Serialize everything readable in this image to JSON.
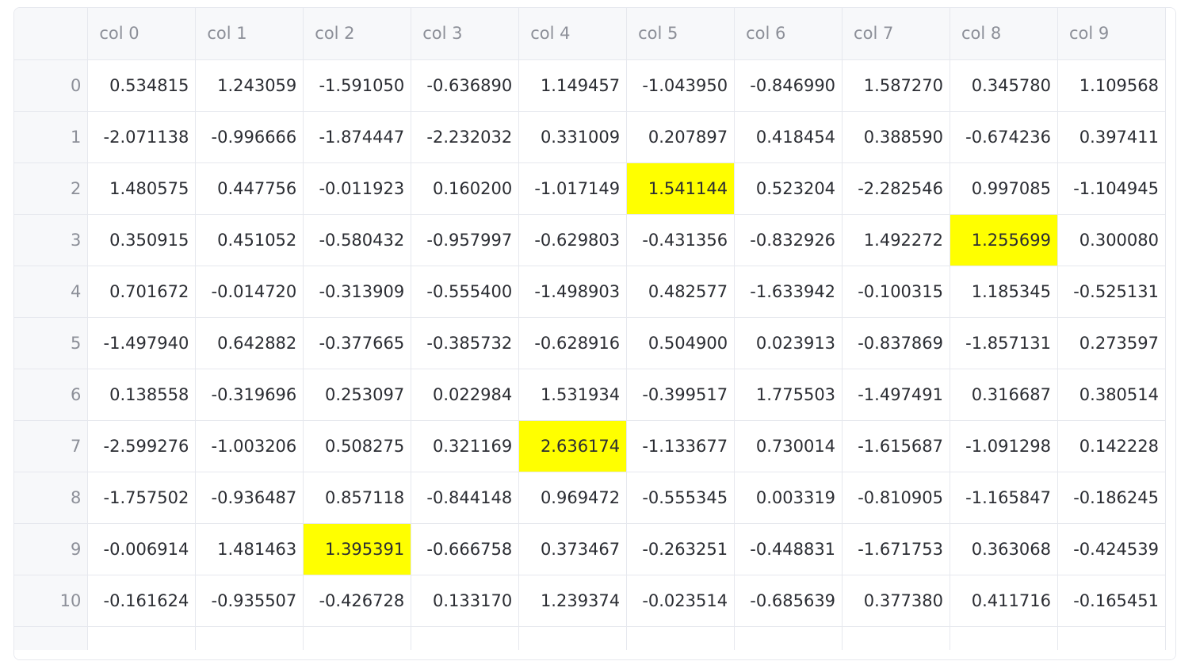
{
  "table": {
    "columns": [
      "col 0",
      "col 1",
      "col 2",
      "col 3",
      "col 4",
      "col 5",
      "col 6",
      "col 7",
      "col 8",
      "col 9"
    ],
    "rows": [
      {
        "index": "0",
        "cells": [
          "0.534815",
          "1.243059",
          "-1.591050",
          "-0.636890",
          "1.149457",
          "-1.043950",
          "-0.846990",
          "1.587270",
          "0.345780",
          "1.109568"
        ],
        "highlight": []
      },
      {
        "index": "1",
        "cells": [
          "-2.071138",
          "-0.996666",
          "-1.874447",
          "-2.232032",
          "0.331009",
          "0.207897",
          "0.418454",
          "0.388590",
          "-0.674236",
          "0.397411"
        ],
        "highlight": []
      },
      {
        "index": "2",
        "cells": [
          "1.480575",
          "0.447756",
          "-0.011923",
          "0.160200",
          "-1.017149",
          "1.541144",
          "0.523204",
          "-2.282546",
          "0.997085",
          "-1.104945"
        ],
        "highlight": [
          5
        ]
      },
      {
        "index": "3",
        "cells": [
          "0.350915",
          "0.451052",
          "-0.580432",
          "-0.957997",
          "-0.629803",
          "-0.431356",
          "-0.832926",
          "1.492272",
          "1.255699",
          "0.300080"
        ],
        "highlight": [
          8
        ]
      },
      {
        "index": "4",
        "cells": [
          "0.701672",
          "-0.014720",
          "-0.313909",
          "-0.555400",
          "-1.498903",
          "0.482577",
          "-1.633942",
          "-0.100315",
          "1.185345",
          "-0.525131"
        ],
        "highlight": []
      },
      {
        "index": "5",
        "cells": [
          "-1.497940",
          "0.642882",
          "-0.377665",
          "-0.385732",
          "-0.628916",
          "0.504900",
          "0.023913",
          "-0.837869",
          "-1.857131",
          "0.273597"
        ],
        "highlight": []
      },
      {
        "index": "6",
        "cells": [
          "0.138558",
          "-0.319696",
          "0.253097",
          "0.022984",
          "1.531934",
          "-0.399517",
          "1.775503",
          "-1.497491",
          "0.316687",
          "0.380514"
        ],
        "highlight": []
      },
      {
        "index": "7",
        "cells": [
          "-2.599276",
          "-1.003206",
          "0.508275",
          "0.321169",
          "2.636174",
          "-1.133677",
          "0.730014",
          "-1.615687",
          "-1.091298",
          "0.142228"
        ],
        "highlight": [
          4
        ]
      },
      {
        "index": "8",
        "cells": [
          "-1.757502",
          "-0.936487",
          "0.857118",
          "-0.844148",
          "0.969472",
          "-0.555345",
          "0.003319",
          "-0.810905",
          "-1.165847",
          "-0.186245"
        ],
        "highlight": []
      },
      {
        "index": "9",
        "cells": [
          "-0.006914",
          "1.481463",
          "1.395391",
          "-0.666758",
          "0.373467",
          "-0.263251",
          "-0.448831",
          "-1.671753",
          "0.363068",
          "-0.424539"
        ],
        "highlight": [
          2
        ]
      },
      {
        "index": "10",
        "cells": [
          "-0.161624",
          "-0.935507",
          "-0.426728",
          "0.133170",
          "1.239374",
          "-0.023514",
          "-0.685639",
          "0.377380",
          "0.411716",
          "-0.165451"
        ],
        "highlight": []
      }
    ]
  },
  "colors": {
    "highlight": "#ffff00",
    "header_bg": "#f7f8fa",
    "border": "#e6e8ee",
    "text": "#2b2d33",
    "muted": "#8c8f98"
  }
}
